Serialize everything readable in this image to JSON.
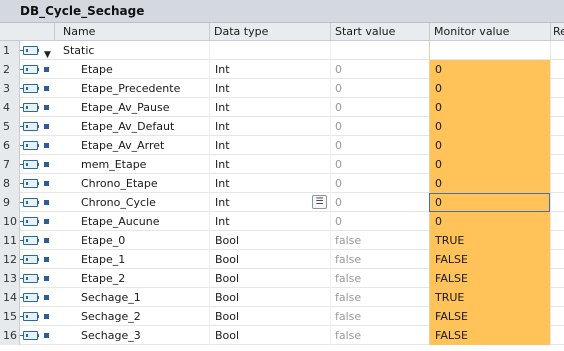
{
  "window": {
    "title": "DB_Cycle_Sechage"
  },
  "columns": [
    "Name",
    "Data type",
    "Start value",
    "Monitor value",
    "Re"
  ],
  "rows": [
    {
      "idx": "1",
      "name": "Static",
      "type": "",
      "start": "",
      "monitor": "",
      "kind": "group"
    },
    {
      "idx": "2",
      "name": "Etape",
      "type": "Int",
      "start": "0",
      "monitor": "0"
    },
    {
      "idx": "3",
      "name": "Etape_Precedente",
      "type": "Int",
      "start": "0",
      "monitor": "0"
    },
    {
      "idx": "4",
      "name": "Etape_Av_Pause",
      "type": "Int",
      "start": "0",
      "monitor": "0"
    },
    {
      "idx": "5",
      "name": "Etape_Av_Defaut",
      "type": "Int",
      "start": "0",
      "monitor": "0"
    },
    {
      "idx": "6",
      "name": "Etape_Av_Arret",
      "type": "Int",
      "start": "0",
      "monitor": "0"
    },
    {
      "idx": "7",
      "name": "mem_Etape",
      "type": "Int",
      "start": "0",
      "monitor": "0"
    },
    {
      "idx": "8",
      "name": "Chrono_Etape",
      "type": "Int",
      "start": "0",
      "monitor": "0"
    },
    {
      "idx": "9",
      "name": "Chrono_Cycle",
      "type": "Int",
      "start": "0",
      "monitor": "0",
      "selected": true
    },
    {
      "idx": "10",
      "name": "Etape_Aucune",
      "type": "Int",
      "start": "0",
      "monitor": "0"
    },
    {
      "idx": "11",
      "name": "Etape_0",
      "type": "Bool",
      "start": "false",
      "monitor": "TRUE"
    },
    {
      "idx": "12",
      "name": "Etape_1",
      "type": "Bool",
      "start": "false",
      "monitor": "FALSE"
    },
    {
      "idx": "13",
      "name": "Etape_2",
      "type": "Bool",
      "start": "false",
      "monitor": "FALSE"
    },
    {
      "idx": "14",
      "name": "Sechage_1",
      "type": "Bool",
      "start": "false",
      "monitor": "TRUE"
    },
    {
      "idx": "15",
      "name": "Sechage_2",
      "type": "Bool",
      "start": "false",
      "monitor": "FALSE"
    },
    {
      "idx": "16",
      "name": "Sechage_3",
      "type": "Bool",
      "start": "false",
      "monitor": "FALSE"
    }
  ],
  "icons": {
    "interface": "interface-icon",
    "member": "member-icon",
    "expand": "expand-triangle-icon",
    "dropdown": "dropdown-list-icon"
  },
  "colors": {
    "monitor_fill": "#ffc35a",
    "header_bg": "#e9ecef",
    "title_bg": "#d4d9df"
  }
}
